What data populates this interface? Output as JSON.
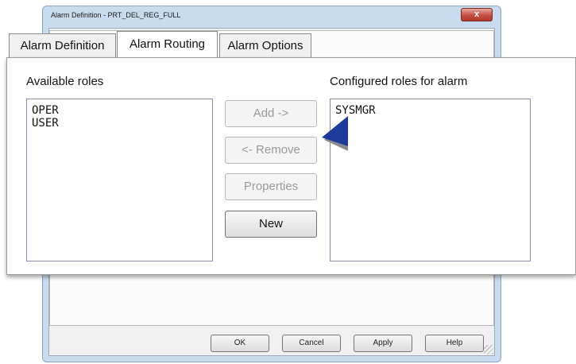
{
  "window": {
    "title": "Alarm Definition - PRT_DEL_REG_FULL",
    "close_glyph": "x"
  },
  "tabs": [
    {
      "label": "Alarm Definition",
      "active": false
    },
    {
      "label": "Alarm Routing",
      "active": true
    },
    {
      "label": "Alarm Options",
      "active": false
    }
  ],
  "routing": {
    "available_label": "Available roles",
    "available_roles": [
      "OPER",
      "USER"
    ],
    "configured_label": "Configured roles for alarm",
    "configured_roles": [
      "SYSMGR"
    ],
    "buttons": {
      "add": "Add ->",
      "remove": "<- Remove",
      "properties": "Properties",
      "new": "New"
    }
  },
  "footer": {
    "ok": "OK",
    "cancel": "Cancel",
    "apply": "Apply",
    "help": "Help"
  },
  "colors": {
    "cursor_blue": "#1b3c9b",
    "cursor_gray": "#8c8c8c"
  }
}
